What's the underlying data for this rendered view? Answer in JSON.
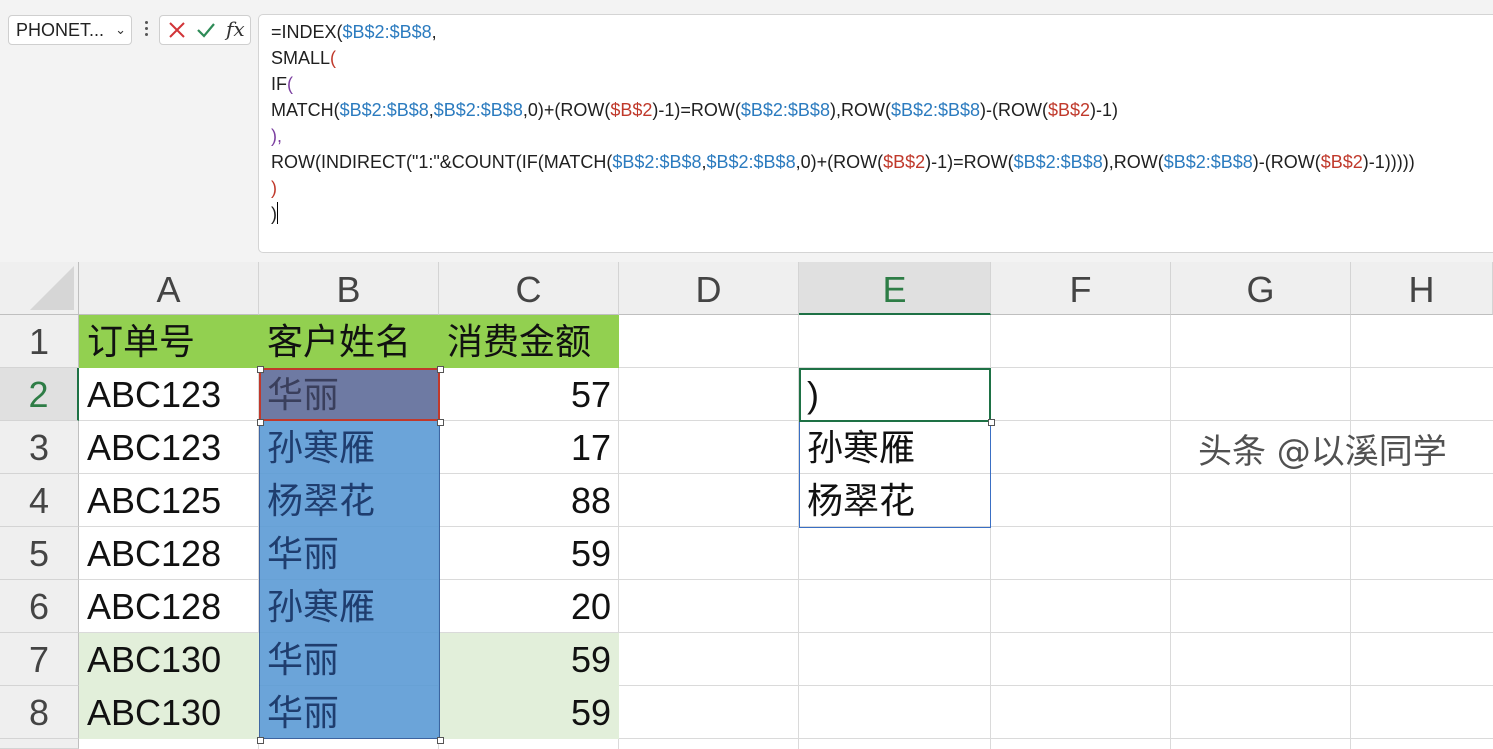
{
  "formula_bar": {
    "name_box": "PHONET...",
    "fx_label": "fx",
    "lines": [
      [
        {
          "t": "=INDEX(",
          "c": ""
        },
        {
          "t": "$B$2:$B$8",
          "c": "cb"
        },
        {
          "t": ",",
          "c": ""
        }
      ],
      [
        {
          "t": "SMALL",
          "c": ""
        },
        {
          "t": "(",
          "c": "cr"
        }
      ],
      [
        {
          "t": "IF",
          "c": ""
        },
        {
          "t": "(",
          "c": "cp"
        }
      ],
      [
        {
          "t": "MATCH(",
          "c": ""
        },
        {
          "t": "$B$2:$B$8",
          "c": "cb"
        },
        {
          "t": ",",
          "c": ""
        },
        {
          "t": "$B$2:$B$8",
          "c": "cb"
        },
        {
          "t": ",0)+(ROW(",
          "c": ""
        },
        {
          "t": "$B$2",
          "c": "cr"
        },
        {
          "t": ")-1)=ROW(",
          "c": ""
        },
        {
          "t": "$B$2:$B$8",
          "c": "cb"
        },
        {
          "t": "),ROW(",
          "c": ""
        },
        {
          "t": "$B$2:$B$8",
          "c": "cb"
        },
        {
          "t": ")-(ROW(",
          "c": ""
        },
        {
          "t": "$B$2",
          "c": "cr"
        },
        {
          "t": ")-1)",
          "c": ""
        }
      ],
      [
        {
          "t": "),",
          "c": "cp"
        }
      ],
      [
        {
          "t": "ROW(INDIRECT(\"1:\"&COUNT(IF(MATCH(",
          "c": ""
        },
        {
          "t": "$B$2:$B$8",
          "c": "cb"
        },
        {
          "t": ",",
          "c": ""
        },
        {
          "t": "$B$2:$B$8",
          "c": "cb"
        },
        {
          "t": ",0)+(ROW(",
          "c": ""
        },
        {
          "t": "$B$2",
          "c": "cr"
        },
        {
          "t": ")-1)=ROW(",
          "c": ""
        },
        {
          "t": "$B$2:$B$8",
          "c": "cb"
        },
        {
          "t": "),ROW(",
          "c": ""
        },
        {
          "t": "$B$2:$B$8",
          "c": "cb"
        },
        {
          "t": ")-(ROW(",
          "c": ""
        },
        {
          "t": "$B$2",
          "c": "cr"
        },
        {
          "t": ")-1)))))",
          "c": ""
        }
      ],
      [
        {
          "t": ")",
          "c": "cr"
        }
      ],
      [
        {
          "t": ")",
          "c": ""
        }
      ]
    ]
  },
  "columns": [
    "A",
    "B",
    "C",
    "D",
    "E",
    "F",
    "G",
    "H"
  ],
  "rows": [
    "1",
    "2",
    "3",
    "4",
    "5",
    "6",
    "7",
    "8"
  ],
  "table": {
    "headers": [
      "订单号",
      "客户姓名",
      "消费金额"
    ],
    "data": [
      [
        "ABC123",
        "华丽",
        "57"
      ],
      [
        "ABC123",
        "孙寒雁",
        "17"
      ],
      [
        "ABC125",
        "杨翠花",
        "88"
      ],
      [
        "ABC128",
        "华丽",
        "59"
      ],
      [
        "ABC128",
        "孙寒雁",
        "20"
      ],
      [
        "ABC130",
        "华丽",
        "59"
      ],
      [
        "ABC130",
        "华丽",
        "59"
      ]
    ]
  },
  "column_e": {
    "active_cell_text": ")",
    "spill_values": [
      "孙寒雁",
      "杨翠花"
    ]
  },
  "watermark": "头条 @以溪同学",
  "colors": {
    "header_fill": "#92d050",
    "light_green_fill": "#e2efda",
    "selection_fill": "#5b9bd5",
    "active_border": "#1e7145"
  }
}
